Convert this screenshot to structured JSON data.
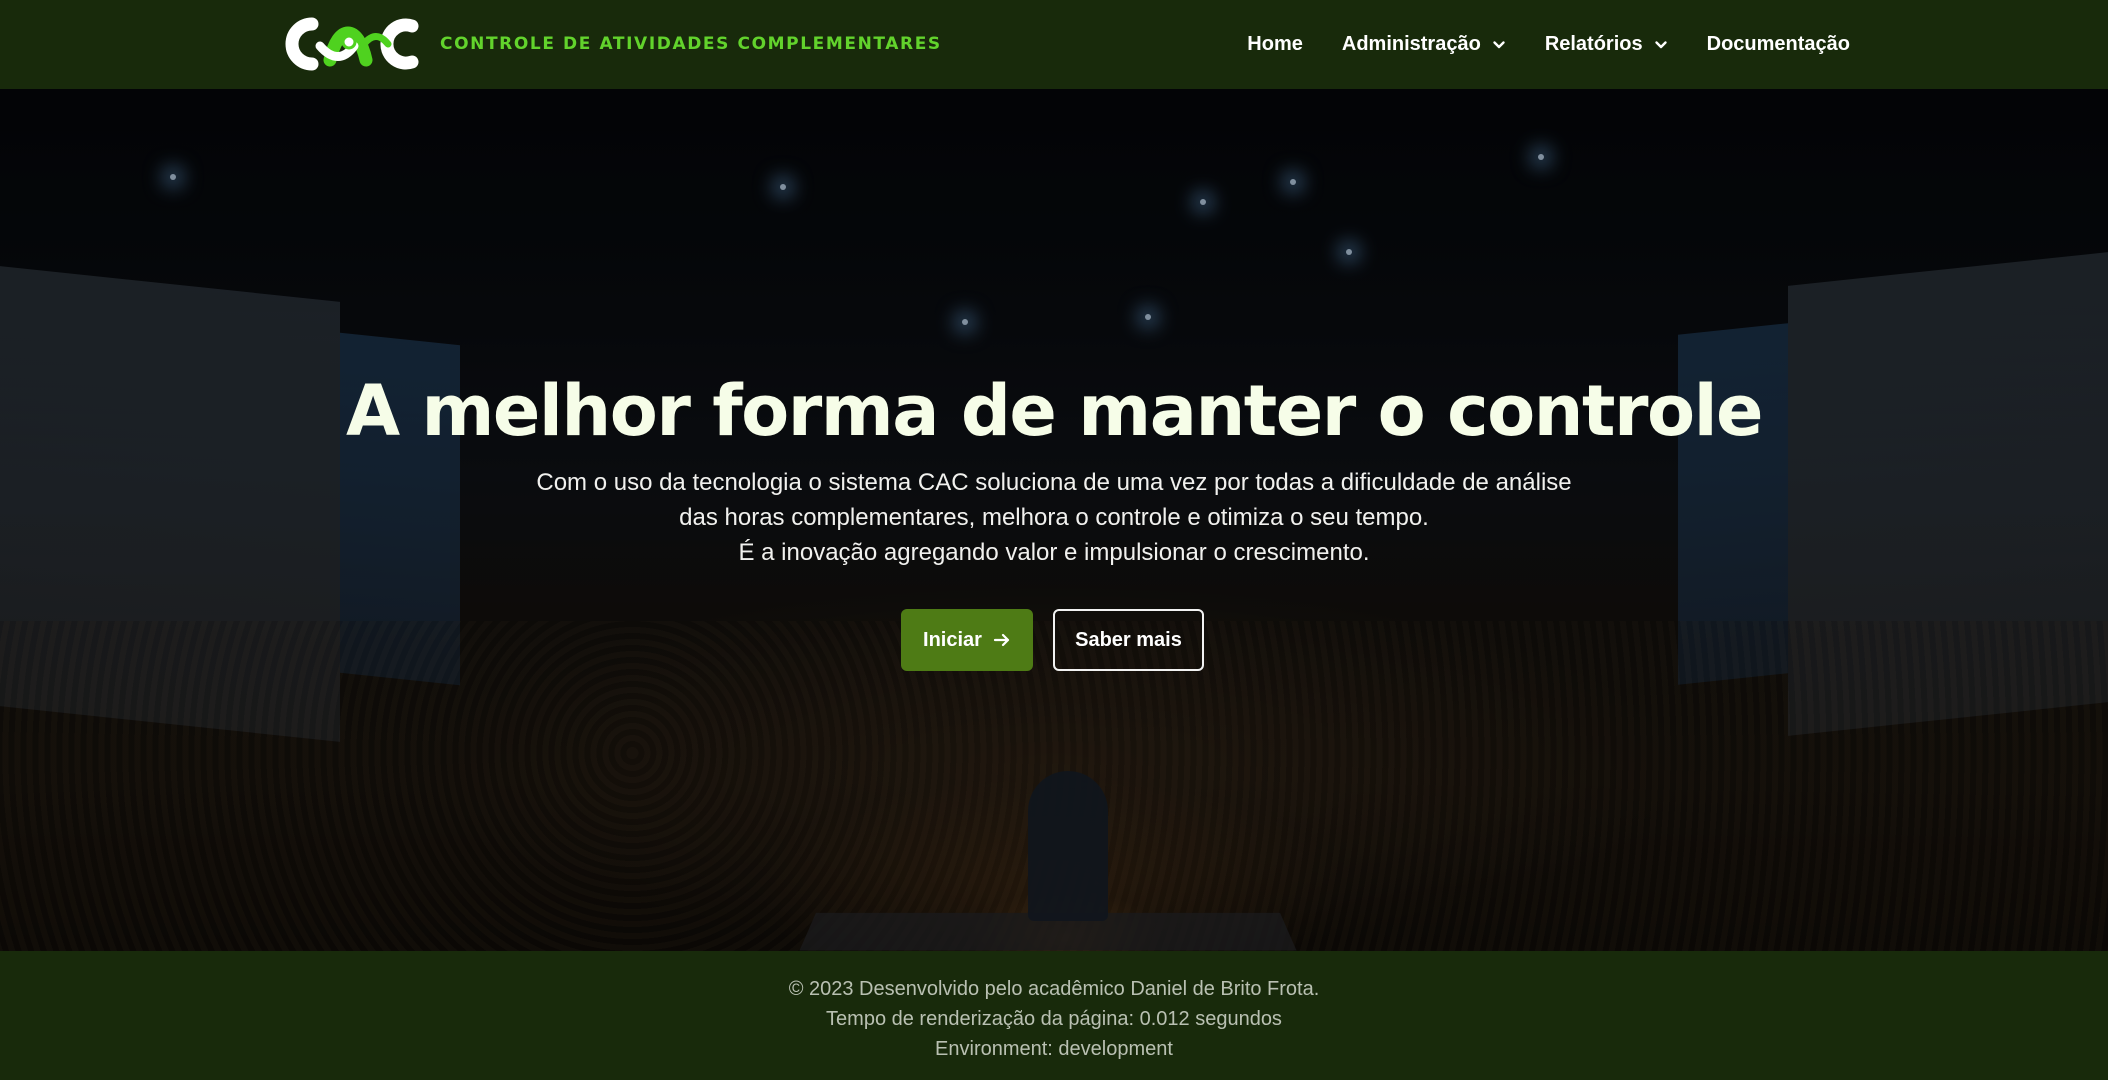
{
  "navbar": {
    "brand_text": "CONTROLE DE ATIVIDADES COMPLEMENTARES",
    "items": [
      {
        "label": "Home",
        "has_dropdown": false
      },
      {
        "label": "Administração",
        "has_dropdown": true
      },
      {
        "label": "Relatórios",
        "has_dropdown": true
      },
      {
        "label": "Documentação",
        "has_dropdown": false
      }
    ]
  },
  "hero": {
    "title": "A melhor forma de manter o controle",
    "lines": [
      "Com o uso da tecnologia o sistema CAC soluciona de uma vez por todas a dificuldade de análise",
      "das horas complementares, melhora o controle e otimiza o seu tempo.",
      "É a inovação agregando valor e impulsionar o crescimento."
    ],
    "primary_button": "Iniciar",
    "primary_icon": "arrow-right-icon",
    "secondary_button": "Saber mais"
  },
  "footer": {
    "copyright": "© 2023 Desenvolvido pelo acadêmico Daniel de Brito Frota.",
    "render_time": "Tempo de renderização da página: 0.012 segundos",
    "environment": "Environment: development"
  },
  "colors": {
    "nav_bg": "#182a0b",
    "brand_green": "#62d32c",
    "button_green": "#4e7b15",
    "title_color": "#f6fde8"
  }
}
